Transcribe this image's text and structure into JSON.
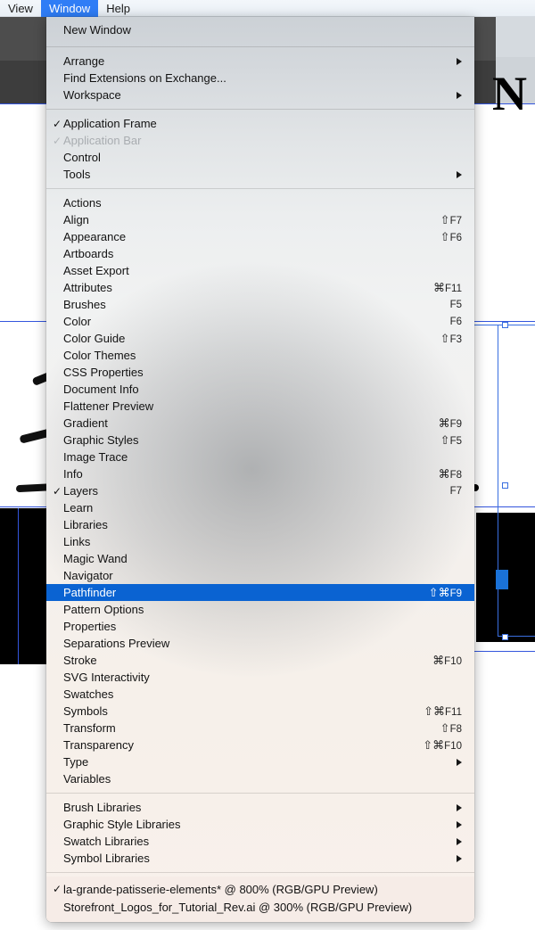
{
  "menubar": {
    "items": [
      {
        "label": "View",
        "active": false
      },
      {
        "label": "Window",
        "active": true
      },
      {
        "label": "Help",
        "active": false
      }
    ]
  },
  "artwork": {
    "letter": "N"
  },
  "menu": {
    "sections": [
      {
        "name": "new-window",
        "items": [
          {
            "label": "New Window",
            "accel": "",
            "check": "",
            "submenu": false,
            "disabled": false,
            "selected": false
          }
        ]
      },
      {
        "name": "arrange",
        "items": [
          {
            "label": "Arrange",
            "accel": "",
            "check": "",
            "submenu": true,
            "disabled": false,
            "selected": false
          },
          {
            "label": "Find Extensions on Exchange...",
            "accel": "",
            "check": "",
            "submenu": false,
            "disabled": false,
            "selected": false
          },
          {
            "label": "Workspace",
            "accel": "",
            "check": "",
            "submenu": true,
            "disabled": false,
            "selected": false
          }
        ]
      },
      {
        "name": "frame-bars",
        "items": [
          {
            "label": "Application Frame",
            "accel": "",
            "check": "✓",
            "submenu": false,
            "disabled": false,
            "selected": false
          },
          {
            "label": "Application Bar",
            "accel": "",
            "check": "✓",
            "submenu": false,
            "disabled": true,
            "selected": false
          },
          {
            "label": "Control",
            "accel": "",
            "check": "",
            "submenu": false,
            "disabled": false,
            "selected": false
          },
          {
            "label": "Tools",
            "accel": "",
            "check": "",
            "submenu": true,
            "disabled": false,
            "selected": false
          }
        ]
      },
      {
        "name": "panels",
        "items": [
          {
            "label": "Actions",
            "accel": "",
            "check": "",
            "submenu": false,
            "disabled": false,
            "selected": false
          },
          {
            "label": "Align",
            "accel": "⇧F7",
            "check": "",
            "submenu": false,
            "disabled": false,
            "selected": false
          },
          {
            "label": "Appearance",
            "accel": "⇧F6",
            "check": "",
            "submenu": false,
            "disabled": false,
            "selected": false
          },
          {
            "label": "Artboards",
            "accel": "",
            "check": "",
            "submenu": false,
            "disabled": false,
            "selected": false
          },
          {
            "label": "Asset Export",
            "accel": "",
            "check": "",
            "submenu": false,
            "disabled": false,
            "selected": false
          },
          {
            "label": "Attributes",
            "accel": "⌘F11",
            "check": "",
            "submenu": false,
            "disabled": false,
            "selected": false
          },
          {
            "label": "Brushes",
            "accel": "F5",
            "check": "",
            "submenu": false,
            "disabled": false,
            "selected": false
          },
          {
            "label": "Color",
            "accel": "F6",
            "check": "",
            "submenu": false,
            "disabled": false,
            "selected": false
          },
          {
            "label": "Color Guide",
            "accel": "⇧F3",
            "check": "",
            "submenu": false,
            "disabled": false,
            "selected": false
          },
          {
            "label": "Color Themes",
            "accel": "",
            "check": "",
            "submenu": false,
            "disabled": false,
            "selected": false
          },
          {
            "label": "CSS Properties",
            "accel": "",
            "check": "",
            "submenu": false,
            "disabled": false,
            "selected": false
          },
          {
            "label": "Document Info",
            "accel": "",
            "check": "",
            "submenu": false,
            "disabled": false,
            "selected": false
          },
          {
            "label": "Flattener Preview",
            "accel": "",
            "check": "",
            "submenu": false,
            "disabled": false,
            "selected": false
          },
          {
            "label": "Gradient",
            "accel": "⌘F9",
            "check": "",
            "submenu": false,
            "disabled": false,
            "selected": false
          },
          {
            "label": "Graphic Styles",
            "accel": "⇧F5",
            "check": "",
            "submenu": false,
            "disabled": false,
            "selected": false
          },
          {
            "label": "Image Trace",
            "accel": "",
            "check": "",
            "submenu": false,
            "disabled": false,
            "selected": false
          },
          {
            "label": "Info",
            "accel": "⌘F8",
            "check": "",
            "submenu": false,
            "disabled": false,
            "selected": false
          },
          {
            "label": "Layers",
            "accel": "F7",
            "check": "✓",
            "submenu": false,
            "disabled": false,
            "selected": false
          },
          {
            "label": "Learn",
            "accel": "",
            "check": "",
            "submenu": false,
            "disabled": false,
            "selected": false
          },
          {
            "label": "Libraries",
            "accel": "",
            "check": "",
            "submenu": false,
            "disabled": false,
            "selected": false
          },
          {
            "label": "Links",
            "accel": "",
            "check": "",
            "submenu": false,
            "disabled": false,
            "selected": false
          },
          {
            "label": "Magic Wand",
            "accel": "",
            "check": "",
            "submenu": false,
            "disabled": false,
            "selected": false
          },
          {
            "label": "Navigator",
            "accel": "",
            "check": "",
            "submenu": false,
            "disabled": false,
            "selected": false
          },
          {
            "label": "Pathfinder",
            "accel": "⇧⌘F9",
            "check": "",
            "submenu": false,
            "disabled": false,
            "selected": true
          },
          {
            "label": "Pattern Options",
            "accel": "",
            "check": "",
            "submenu": false,
            "disabled": false,
            "selected": false
          },
          {
            "label": "Properties",
            "accel": "",
            "check": "",
            "submenu": false,
            "disabled": false,
            "selected": false
          },
          {
            "label": "Separations Preview",
            "accel": "",
            "check": "",
            "submenu": false,
            "disabled": false,
            "selected": false
          },
          {
            "label": "Stroke",
            "accel": "⌘F10",
            "check": "",
            "submenu": false,
            "disabled": false,
            "selected": false
          },
          {
            "label": "SVG Interactivity",
            "accel": "",
            "check": "",
            "submenu": false,
            "disabled": false,
            "selected": false
          },
          {
            "label": "Swatches",
            "accel": "",
            "check": "",
            "submenu": false,
            "disabled": false,
            "selected": false
          },
          {
            "label": "Symbols",
            "accel": "⇧⌘F11",
            "check": "",
            "submenu": false,
            "disabled": false,
            "selected": false
          },
          {
            "label": "Transform",
            "accel": "⇧F8",
            "check": "",
            "submenu": false,
            "disabled": false,
            "selected": false
          },
          {
            "label": "Transparency",
            "accel": "⇧⌘F10",
            "check": "",
            "submenu": false,
            "disabled": false,
            "selected": false
          },
          {
            "label": "Type",
            "accel": "",
            "check": "",
            "submenu": true,
            "disabled": false,
            "selected": false
          },
          {
            "label": "Variables",
            "accel": "",
            "check": "",
            "submenu": false,
            "disabled": false,
            "selected": false
          }
        ]
      },
      {
        "name": "libraries",
        "items": [
          {
            "label": "Brush Libraries",
            "accel": "",
            "check": "",
            "submenu": true,
            "disabled": false,
            "selected": false
          },
          {
            "label": "Graphic Style Libraries",
            "accel": "",
            "check": "",
            "submenu": true,
            "disabled": false,
            "selected": false
          },
          {
            "label": "Swatch Libraries",
            "accel": "",
            "check": "",
            "submenu": true,
            "disabled": false,
            "selected": false
          },
          {
            "label": "Symbol Libraries",
            "accel": "",
            "check": "",
            "submenu": true,
            "disabled": false,
            "selected": false
          }
        ]
      }
    ],
    "documents": [
      {
        "label": "la-grande-patisserie-elements* @ 800% (RGB/GPU Preview)",
        "check": "✓",
        "selected": false
      },
      {
        "label": "Storefront_Logos_for_Tutorial_Rev.ai @ 300% (RGB/GPU Preview)",
        "check": "",
        "selected": false
      }
    ]
  },
  "colors": {
    "highlight": "#0a63d2",
    "menubar_active": "#2f7df6",
    "footer_bg": "#f6ece7",
    "guide_blue": "#3355dd",
    "selection_blue": "#3a6fe0"
  }
}
